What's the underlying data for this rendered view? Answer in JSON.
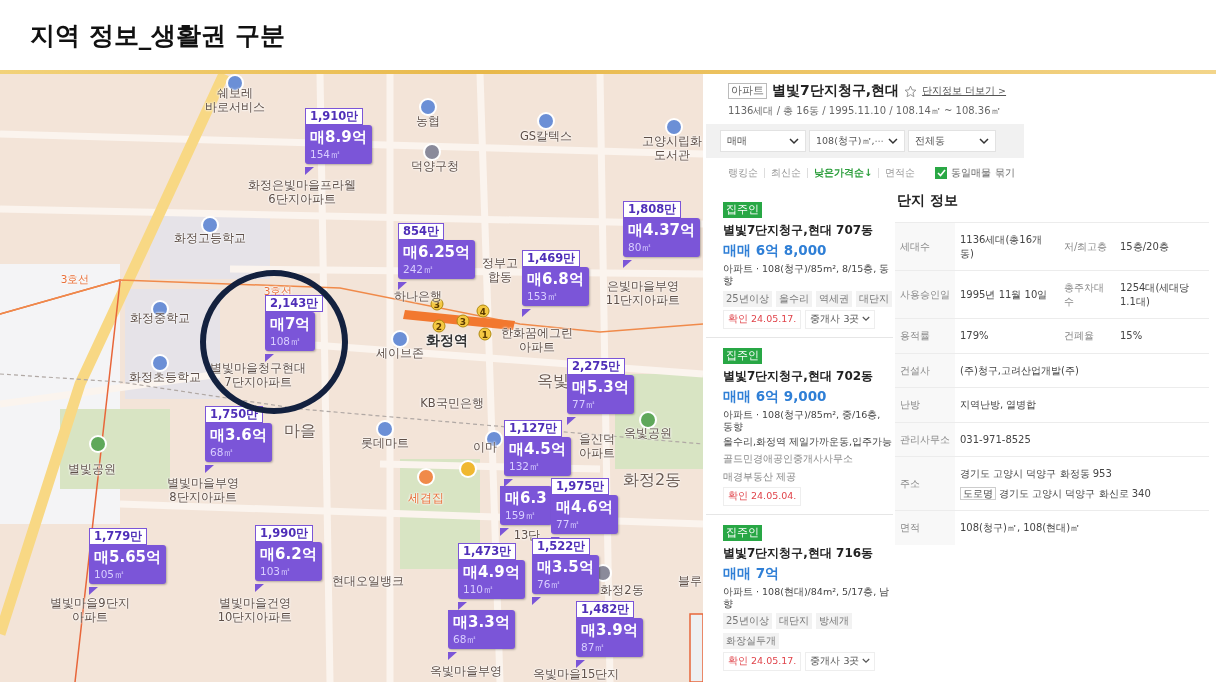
{
  "slide": {
    "title": "지역 정보_생활권 구분"
  },
  "map": {
    "labels": [
      {
        "text": "쉐보레\n바로서비스",
        "kind": "place"
      },
      {
        "text": "농협",
        "kind": "place"
      },
      {
        "text": "GS칼텍스",
        "kind": "place"
      },
      {
        "text": "고양시립화\n도서관",
        "kind": "place"
      },
      {
        "text": "덕양구청",
        "kind": "place"
      },
      {
        "text": "화정은빛마을프라웰\n6단지아파트",
        "kind": "place"
      },
      {
        "text": "화정고등학교",
        "kind": "place"
      },
      {
        "text": "3호선",
        "kind": "line"
      },
      {
        "text": "정부고\n합동",
        "kind": "place"
      },
      {
        "text": "3호선",
        "kind": "line"
      },
      {
        "text": "하나은행",
        "kind": "place"
      },
      {
        "text": "은빛마을부영\n11단지아파트",
        "kind": "place"
      },
      {
        "text": "화정중학교",
        "kind": "place"
      },
      {
        "text": "세이브존",
        "kind": "place"
      },
      {
        "text": "화정역",
        "kind": "station"
      },
      {
        "text": "한화꿈에그린\n아파트",
        "kind": "place"
      },
      {
        "text": "화정초등학교",
        "kind": "place"
      },
      {
        "text": "별빛마을청구현대\n7단지아파트",
        "kind": "place"
      },
      {
        "text": "옥빛",
        "kind": "district"
      },
      {
        "text": "KB국민은행",
        "kind": "place"
      },
      {
        "text": "마을",
        "kind": "district"
      },
      {
        "text": "롯데마트",
        "kind": "place"
      },
      {
        "text": "이마",
        "kind": "place"
      },
      {
        "text": "을신덕\n아파트",
        "kind": "place"
      },
      {
        "text": "옥빛공원",
        "kind": "place"
      },
      {
        "text": "별빛공원",
        "kind": "place"
      },
      {
        "text": "별빛마을부영\n8단지아파트",
        "kind": "place"
      },
      {
        "text": "세겹집",
        "kind": "food"
      },
      {
        "text": "화정2동",
        "kind": "district"
      },
      {
        "text": "13단",
        "kind": "place"
      },
      {
        "text": "현대오일뱅크",
        "kind": "place"
      },
      {
        "text": "화정2동",
        "kind": "place"
      },
      {
        "text": "블루",
        "kind": "place"
      },
      {
        "text": "별빛마을9단지\n아파트",
        "kind": "place"
      },
      {
        "text": "별빛마을건영\n10단지아파트",
        "kind": "place"
      },
      {
        "text": "옥빛마을부영",
        "kind": "place"
      },
      {
        "text": "옥빛마을15단지",
        "kind": "place"
      }
    ],
    "station_exits": [
      {
        "label": "3"
      },
      {
        "label": "4"
      },
      {
        "label": "2"
      },
      {
        "label": "3"
      },
      {
        "label": "1"
      }
    ],
    "markers": [
      {
        "unit_price": "1,910만",
        "price": "매8.9억",
        "area": "154㎡",
        "highlighted": false
      },
      {
        "unit_price": "854만",
        "price": "매6.25억",
        "area": "242㎡",
        "highlighted": false
      },
      {
        "unit_price": "1,808만",
        "price": "매4.37억",
        "area": "80㎡",
        "highlighted": false
      },
      {
        "unit_price": "1,469만",
        "price": "매6.8억",
        "area": "153㎡",
        "highlighted": false
      },
      {
        "unit_price": "2,143만",
        "price": "매7억",
        "area": "108㎡",
        "highlighted": true
      },
      {
        "unit_price": "2,275만",
        "price": "매5.3억",
        "area": "77㎡",
        "highlighted": false
      },
      {
        "unit_price": "1,750만",
        "price": "매3.6억",
        "area": "68㎡",
        "highlighted": false
      },
      {
        "unit_price": "1,127만",
        "price": "매4.5억",
        "area": "132㎡",
        "highlighted": false
      },
      {
        "price": "매6.3",
        "area": "159㎡",
        "highlighted": false
      },
      {
        "unit_price": "1,975만",
        "price": "매4.6억",
        "area": "77㎡",
        "highlighted": false
      },
      {
        "unit_price": "1,779만",
        "price": "매5.65억",
        "area": "105㎡",
        "highlighted": false
      },
      {
        "unit_price": "1,990만",
        "price": "매6.2억",
        "area": "103㎡",
        "highlighted": false
      },
      {
        "unit_price": "1,473만",
        "price": "매4.9억",
        "area": "110㎡",
        "highlighted": false
      },
      {
        "price": "매3.3억",
        "area": "68㎡",
        "highlighted": false
      },
      {
        "unit_price": "1,522만",
        "price": "매3.5억",
        "area": "76㎡",
        "highlighted": false
      },
      {
        "unit_price": "1,482만",
        "price": "매3.9억",
        "area": "87㎡",
        "highlighted": false
      }
    ]
  },
  "complex": {
    "badge": "아파트",
    "name": "별빛7단지청구,현대",
    "info_link": "단지정보 더보기 >",
    "summary": "1136세대 / 총 16동 / 1995.11.10 / 108.14㎡ ~ 108.36㎡",
    "filters": [
      "매매",
      "108(청구)㎡,⋯",
      "전체동"
    ],
    "sorts": [
      {
        "label": "랭킹순",
        "selected": false
      },
      {
        "label": "최신순",
        "selected": false
      },
      {
        "label": "낮은가격순↓",
        "selected": true
      },
      {
        "label": "면적순",
        "selected": false
      }
    ],
    "group_checkbox": {
      "label": "동일매물 묶기",
      "checked": true
    }
  },
  "listings": [
    {
      "tag": "집주인",
      "name": "별빛7단지청구,현대 707동",
      "price": "매매 6억 8,000",
      "desc": "아파트 · 108(청구)/85m², 8/15층, 동향",
      "chips": [
        "25년이상",
        "올수리",
        "역세권",
        "대단지"
      ],
      "confirmed": "확인 24.05.17.",
      "agents": "중개사 3곳"
    },
    {
      "tag": "집주인",
      "name": "별빛7단지청구,현대 702동",
      "price": "매매 6억 9,000",
      "desc": "아파트 · 108(청구)/85m², 중/16층, 동향",
      "note": "올수리,화정역 제일가까운동,입주가능",
      "sources": [
        "골드민경애공인중개사사무소",
        "매경부동산 제공"
      ],
      "confirmed": "확인 24.05.04."
    },
    {
      "tag": "집주인",
      "name": "별빛7단지청구,현대 716동",
      "price": "매매 7억",
      "desc": "아파트 · 108(현대)/84m², 5/17층, 남향",
      "chips": [
        "25년이상",
        "대단지",
        "방세개",
        "화장실두개"
      ],
      "confirmed": "확인 24.05.17.",
      "agents": "중개사 3곳"
    }
  ],
  "detail": {
    "title": "단지 정보",
    "rows": [
      {
        "cells": [
          {
            "label": "세대수",
            "value": "1136세대(총16개동)"
          },
          {
            "label": "저/최고층",
            "value": "15층/20층"
          }
        ]
      },
      {
        "cells": [
          {
            "label": "사용승인일",
            "value": "1995년 11월 10일"
          },
          {
            "label": "총주차대수",
            "value": "1254대(세대당 1.1대)"
          }
        ]
      },
      {
        "cells": [
          {
            "label": "용적률",
            "value": "179%"
          },
          {
            "label": "건폐율",
            "value": "15%"
          }
        ]
      },
      {
        "cells": [
          {
            "label": "건설사",
            "value": "(주)청구,고려산업개발(주)"
          }
        ]
      },
      {
        "cells": [
          {
            "label": "난방",
            "value": "지역난방, 열병합"
          }
        ]
      },
      {
        "cells": [
          {
            "label": "관리사무소",
            "value": "031-971-8525"
          }
        ]
      },
      {
        "cells": [
          {
            "label": "주소",
            "value": "경기도 고양시 덕양구 화정동 953",
            "road_tag": "도로명",
            "road_address": "경기도 고양시 덕양구 화신로 340"
          }
        ]
      },
      {
        "cells": [
          {
            "label": "면적",
            "value": "108(청구)㎡, 108(현대)㎡"
          }
        ]
      }
    ]
  }
}
